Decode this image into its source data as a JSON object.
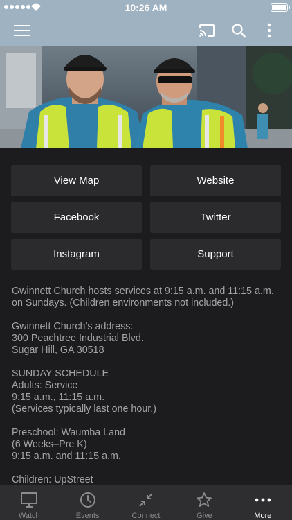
{
  "status_bar": {
    "time": "10:26 AM"
  },
  "app_bar": {
    "icons": [
      "menu-icon",
      "cast-icon",
      "search-icon",
      "more-vertical-icon"
    ]
  },
  "hero": {
    "description_icon": "photo"
  },
  "buttons": [
    {
      "label": "View Map"
    },
    {
      "label": "Website"
    },
    {
      "label": "Facebook"
    },
    {
      "label": "Twitter"
    },
    {
      "label": "Instagram"
    },
    {
      "label": "Support"
    }
  ],
  "info": {
    "p1": {
      "l1": "Gwinnett Church hosts services at 9:15 a.m. and 11:15 a.m.",
      "l2": "on Sundays.  (Children environments not included.)"
    },
    "p2": {
      "l1": "Gwinnett Church’s address:",
      "l2": "300 Peachtree Industrial Blvd.",
      "l3": "Sugar Hill, GA 30518"
    },
    "p3": {
      "l1": "SUNDAY SCHEDULE",
      "l2": "Adults: Service",
      "l3": "9:15 a.m., 11:15 a.m.",
      "l4": "(Services typically last one hour.)"
    },
    "p4": {
      "l1": "Preschool: Waumba Land",
      "l2": "(6 Weeks–Pre K)",
      "l3": "9:15 a.m. and 11:15 a.m."
    },
    "p5": {
      "l1": "Children: UpStreet"
    }
  },
  "tabs": [
    {
      "label": "Watch",
      "icon": "monitor-icon"
    },
    {
      "label": "Events",
      "icon": "clock-icon"
    },
    {
      "label": "Connect",
      "icon": "connect-arrows-icon"
    },
    {
      "label": "Give",
      "icon": "star-icon"
    },
    {
      "label": "More",
      "icon": "more-horizontal-icon",
      "active": true
    }
  ],
  "colors": {
    "app_bar": "#9fb2c2",
    "background": "#1c1c1e",
    "button": "#2b2b2d",
    "tab_bar": "#2e2e30",
    "body_text": "#a4a4a8"
  }
}
